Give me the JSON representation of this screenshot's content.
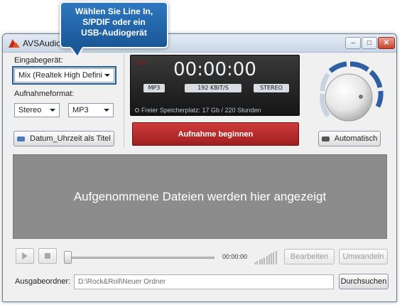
{
  "window": {
    "title": "AVSAudioRecorder",
    "controls": {
      "minimize": "–",
      "maximize": "□",
      "close": "✕"
    }
  },
  "callout": {
    "lines": [
      "Wählen Sie Line In,",
      "S/PDIF oder ein",
      "USB-Audiogerät"
    ]
  },
  "input": {
    "device_label": "Eingabegerät:",
    "device_value": "Mix (Realtek High Defini",
    "format_label": "Aufnahmeformat:",
    "channels_value": "Stereo",
    "codec_value": "MP3"
  },
  "buttons": {
    "datetime_title": "Datum_Uhrzeit als Titel",
    "record": "Aufnahme beginnen",
    "automatic": "Automatisch",
    "edit": "Bearbeiten",
    "convert": "Umwandeln",
    "browse": "Durchsuchen"
  },
  "display": {
    "rec_tag": "REC",
    "timer": "00:00:00",
    "format": "MP3",
    "bitrate": "192 KBIT/S",
    "mode": "STEREO",
    "free_space": "Freier Speicherplatz: 17 Gb / 220 Stunden"
  },
  "drop_area": {
    "message": "Aufgenommene Dateien werden hier angezeigt"
  },
  "player": {
    "time": "00:00:00",
    "position_fraction": 0
  },
  "output": {
    "label": "Ausgabeordner:",
    "path": "D:\\Rock&Roll\\Neuer Ordner"
  },
  "colors": {
    "accent_blue": "#1d5e9e",
    "record_red": "#b82c2c",
    "knob_ring": "#2e5fa3"
  },
  "icons": {
    "app": "avs-logo-icon",
    "datetime": "keyboard-icon",
    "automatic": "keyboard-icon"
  }
}
